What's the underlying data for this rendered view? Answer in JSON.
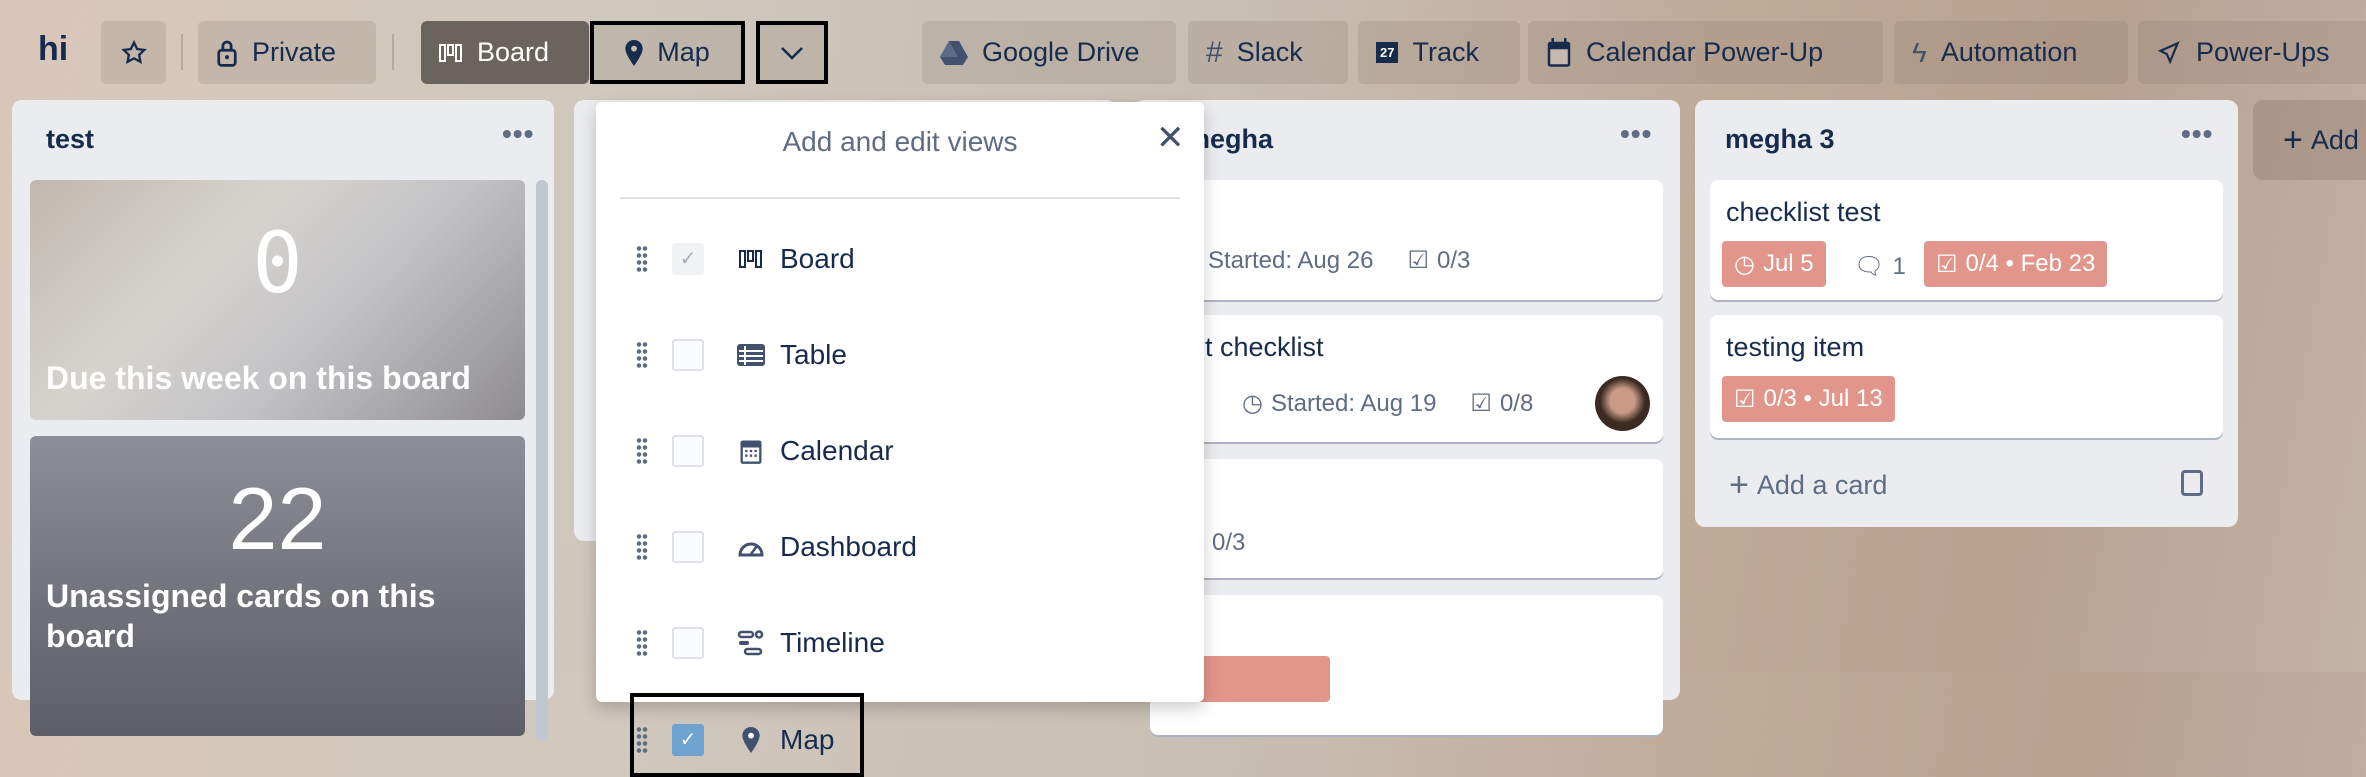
{
  "header": {
    "board_name": "hi",
    "visibility": "Private",
    "views": {
      "board": "Board",
      "map": "Map"
    },
    "powerups": [
      "Google Drive",
      "Slack",
      "Track",
      "Calendar Power-Up",
      "Automation",
      "Power-Ups"
    ],
    "track_icon_text": "27"
  },
  "lists": [
    {
      "title": "test",
      "cards": [
        {
          "count": "0",
          "label": "Due this week on this board"
        },
        {
          "count": "22",
          "label": "Unassigned cards on this board"
        }
      ]
    },
    {
      "title": "megha",
      "cards": [
        {
          "started": "Started: Aug 26",
          "checklist": "0/3"
        },
        {
          "title": "t checklist",
          "started": "Started: Aug 19",
          "checklist": "0/8"
        },
        {
          "checklist": "0/3"
        }
      ]
    },
    {
      "title": "megha 3",
      "cards": [
        {
          "title": "checklist test",
          "due": "Jul 5",
          "comments": "1",
          "checklist": "0/4 • Feb 23"
        },
        {
          "title": "testing item",
          "checklist": "0/3 • Jul 13"
        }
      ],
      "add_card": "Add a card"
    }
  ],
  "add_list": "Add",
  "views_popup": {
    "title": "Add and edit views",
    "items": [
      {
        "label": "Board",
        "checked": true,
        "icon": "board-icon"
      },
      {
        "label": "Table",
        "checked": false,
        "icon": "table-icon"
      },
      {
        "label": "Calendar",
        "checked": false,
        "icon": "calendar-icon"
      },
      {
        "label": "Dashboard",
        "checked": false,
        "icon": "dashboard-icon"
      },
      {
        "label": "Timeline",
        "checked": false,
        "icon": "timeline-icon"
      },
      {
        "label": "Map",
        "checked": true,
        "icon": "map-pin-icon"
      }
    ]
  },
  "colors": {
    "badge": "#e2958a",
    "active_view": "#6b645d",
    "checkbox_checked": "#6fa3d0"
  }
}
